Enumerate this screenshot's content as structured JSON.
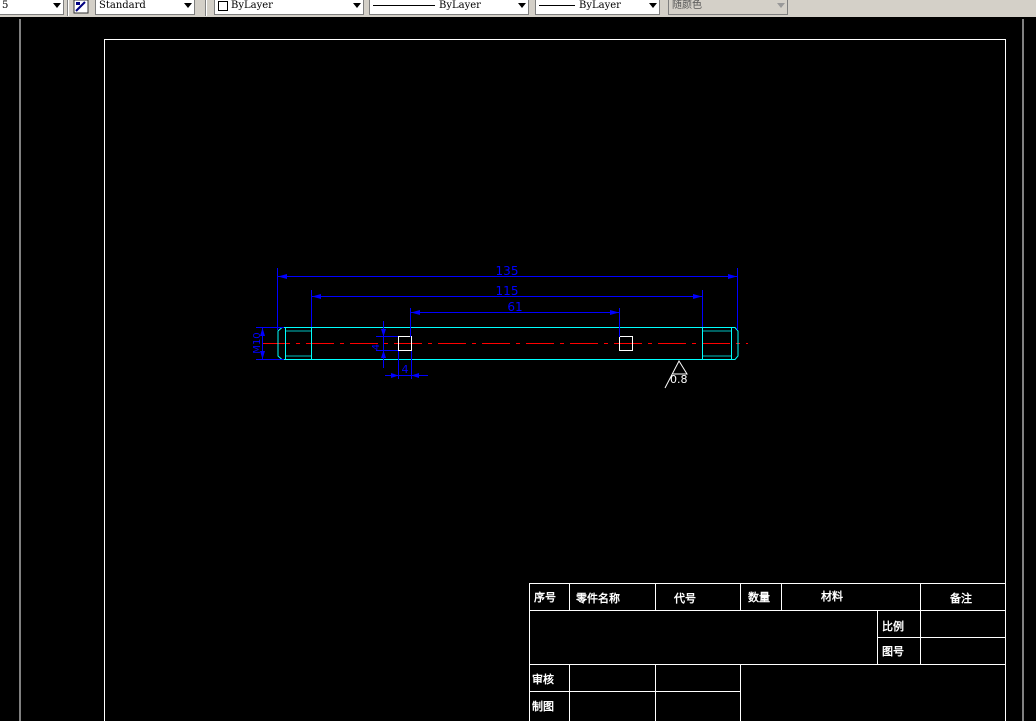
{
  "toolbar": {
    "lineweight_value": "5",
    "textstyle_value": "Standard",
    "layer_value": "ByLayer",
    "linetype_value": "ByLayer",
    "lineweight2_value": "ByLayer",
    "plotstyle_value": "随颜色"
  },
  "drawing": {
    "dimensions": {
      "overall_length": "135",
      "inner_length": "115",
      "hole_spacing": "61",
      "diameter": "M10",
      "hole_size_vertical": "4",
      "hole_size_horizontal": "4",
      "roughness": "0.8"
    },
    "title_block": {
      "header": {
        "seq": "序号",
        "part_name": "零件名称",
        "code": "代号",
        "quantity": "数量",
        "material": "材料",
        "remarks": "备注"
      },
      "scale_label": "比例",
      "drawing_no_label": "图号",
      "reviewer_label": "审核",
      "drafter_label": "制图"
    },
    "colors": {
      "dimension": "#0000ff",
      "part_outline": "#00ffff",
      "center_line": "#ff0000",
      "border": "#ffffff",
      "background": "#000000"
    }
  }
}
